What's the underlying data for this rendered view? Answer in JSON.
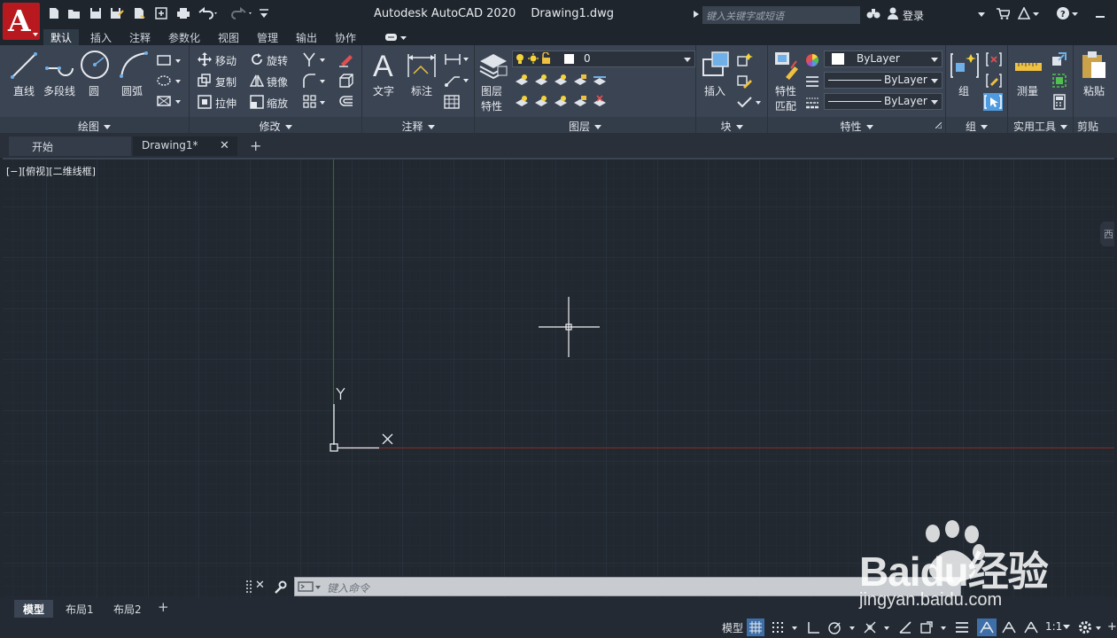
{
  "titlebar": {
    "app_name": "Autodesk AutoCAD 2020",
    "file_name": "Drawing1.dwg",
    "search_placeholder": "键入关键字或短语",
    "login": "登录"
  },
  "ribbon_tabs": [
    "默认",
    "插入",
    "注释",
    "参数化",
    "视图",
    "管理",
    "输出",
    "协作"
  ],
  "panels": {
    "draw": {
      "title": "绘图",
      "line": "直线",
      "polyline": "多段线",
      "circle": "圆",
      "arc": "圆弧"
    },
    "modify": {
      "title": "修改",
      "move": "移动",
      "rotate": "旋转",
      "copy": "复制",
      "mirror": "镜像",
      "stretch": "拉伸",
      "scale": "缩放"
    },
    "annotate": {
      "title": "注释",
      "text": "文字",
      "dimension": "标注"
    },
    "layers": {
      "title": "图层",
      "layer_props_1": "图层",
      "layer_props_2": "特性",
      "current_layer": "0"
    },
    "block": {
      "title": "块",
      "insert": "插入"
    },
    "properties": {
      "title": "特性",
      "match_1": "特性",
      "match_2": "匹配",
      "color": "ByLayer",
      "linetype": "ByLayer",
      "lineweight": "ByLayer"
    },
    "groups": {
      "title": "组",
      "group": "组"
    },
    "utilities": {
      "title": "实用工具",
      "measure": "测量"
    },
    "clipboard": {
      "title": "剪贴",
      "paste": "粘贴"
    }
  },
  "doc_tabs": {
    "start": "开始",
    "drawing": "Drawing1*"
  },
  "viewport": {
    "label": "[−][俯视][二维线框]",
    "ucs_x": "X",
    "ucs_y": "Y",
    "viewcube_label": "西"
  },
  "command_line": {
    "placeholder": "键入命令"
  },
  "layout_tabs": [
    "模型",
    "布局1",
    "布局2"
  ],
  "statusbar": {
    "model": "模型",
    "scale": "1:1"
  },
  "watermark": {
    "brand": "Baidu经验",
    "url": "jingyan.baidu.com"
  },
  "colors": {
    "ribbon_bg": "#3b4453",
    "canvas_bg": "#212830",
    "title_bg": "#1f252d",
    "x_axis": "#7a2a2a",
    "y_axis": "#2f6a2f",
    "logo": "#b7191f"
  }
}
